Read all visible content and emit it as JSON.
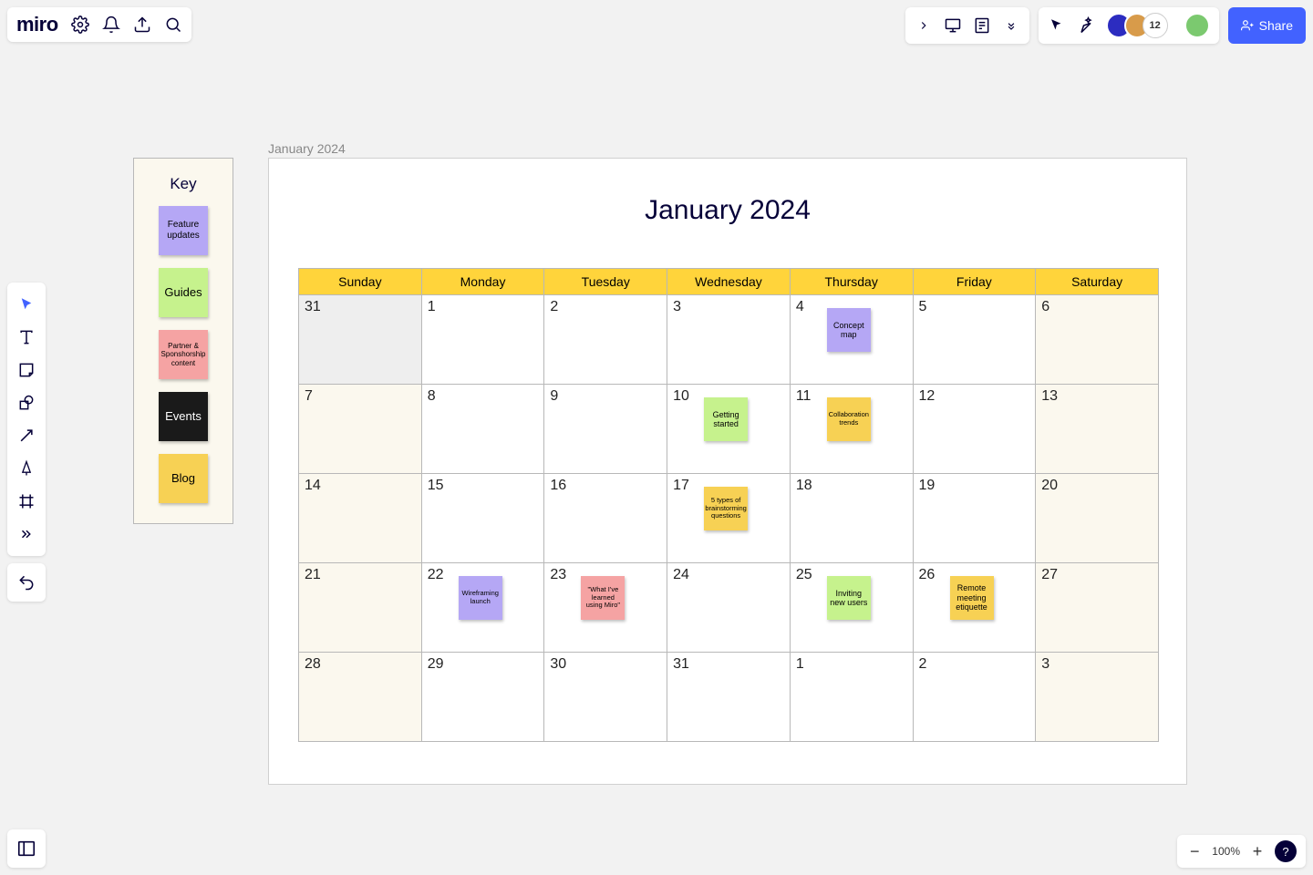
{
  "app": {
    "logo": "miro"
  },
  "header": {
    "collaborator_count": "12",
    "share_label": "Share"
  },
  "canvas": {
    "frame_label": "January 2024",
    "calendar_title": "January 2024",
    "day_headers": [
      "Sunday",
      "Monday",
      "Tuesday",
      "Wednesday",
      "Thursday",
      "Friday",
      "Saturday"
    ],
    "weeks": [
      [
        {
          "n": "31",
          "out": true
        },
        {
          "n": "1"
        },
        {
          "n": "2"
        },
        {
          "n": "3"
        },
        {
          "n": "4",
          "sticky": {
            "text": "Concept map",
            "color": "c-purple"
          }
        },
        {
          "n": "5"
        },
        {
          "n": "6",
          "weekend": true
        }
      ],
      [
        {
          "n": "7",
          "weekend": true
        },
        {
          "n": "8"
        },
        {
          "n": "9"
        },
        {
          "n": "10",
          "sticky": {
            "text": "Getting started",
            "color": "c-green"
          }
        },
        {
          "n": "11",
          "sticky": {
            "text": "Collaboration trends",
            "color": "c-yellow",
            "tiny": true
          }
        },
        {
          "n": "12"
        },
        {
          "n": "13",
          "weekend": true
        }
      ],
      [
        {
          "n": "14",
          "weekend": true
        },
        {
          "n": "15"
        },
        {
          "n": "16"
        },
        {
          "n": "17",
          "sticky": {
            "text": "5 types of brainstorming questions",
            "color": "c-yellow",
            "tiny": true
          }
        },
        {
          "n": "18"
        },
        {
          "n": "19"
        },
        {
          "n": "20",
          "weekend": true
        }
      ],
      [
        {
          "n": "21",
          "weekend": true
        },
        {
          "n": "22",
          "sticky": {
            "text": "Wireframing launch",
            "color": "c-purple",
            "tiny": true
          }
        },
        {
          "n": "23",
          "sticky": {
            "text": "\"What I've learned using Miro\"",
            "color": "c-pink",
            "tiny": true
          }
        },
        {
          "n": "24"
        },
        {
          "n": "25",
          "sticky": {
            "text": "Inviting new users",
            "color": "c-green"
          }
        },
        {
          "n": "26",
          "sticky": {
            "text": "Remote meeting etiquette",
            "color": "c-yellow"
          }
        },
        {
          "n": "27",
          "weekend": true
        }
      ],
      [
        {
          "n": "28",
          "weekend": true
        },
        {
          "n": "29"
        },
        {
          "n": "30"
        },
        {
          "n": "31"
        },
        {
          "n": "1"
        },
        {
          "n": "2"
        },
        {
          "n": "3",
          "weekend": true
        }
      ]
    ],
    "key": {
      "title": "Key",
      "items": [
        {
          "text": "Feature updates",
          "color": "c-purple"
        },
        {
          "text": "Guides",
          "color": "c-green",
          "big": true
        },
        {
          "text": "Partner & Sponshorship content",
          "color": "c-pink",
          "small": true
        },
        {
          "text": "Events",
          "color": "c-black",
          "big": true
        },
        {
          "text": "Blog",
          "color": "c-yellow",
          "big": true
        }
      ]
    }
  },
  "zoom": {
    "value": "100%"
  }
}
